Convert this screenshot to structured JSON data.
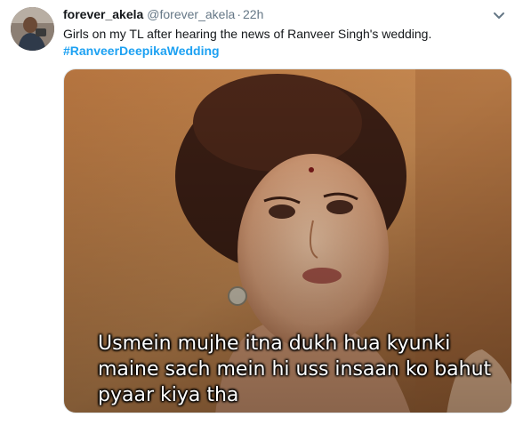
{
  "user": {
    "display_name": "forever_akela",
    "handle": "@forever_akela",
    "separator": "·",
    "time": "22h"
  },
  "tweet": {
    "text": "Girls on my TL after hearing the news of Ranveer Singh's wedding.",
    "hashtag": "#RanveerDeepikaWedding"
  },
  "media": {
    "subtitle_lines": [
      "Usmein mujhe itna dukh hua kyunki",
      "maine sach mein hi uss insaan ko bahut",
      "pyaar kiya tha"
    ]
  },
  "icons": {
    "avatar": "avatar-photo",
    "menu": "chevron-down-icon"
  },
  "colors": {
    "link": "#1da1f2",
    "secondary": "#657786",
    "primary_text": "#14171a"
  }
}
